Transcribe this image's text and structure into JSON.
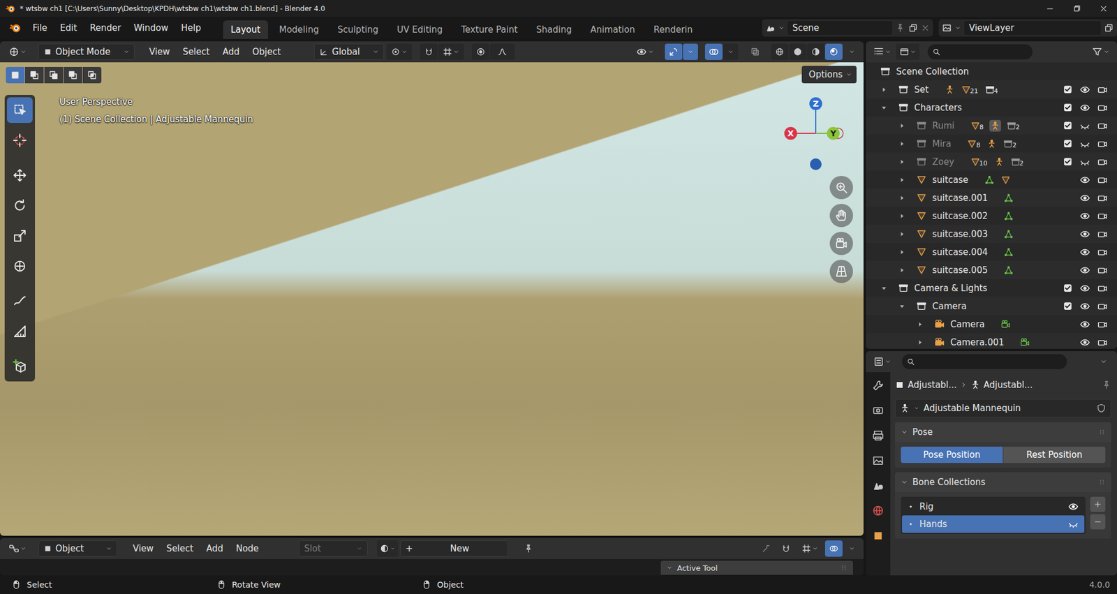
{
  "window": {
    "title": "* wtsbw ch1 [C:\\Users\\Sunny\\Desktop\\KPDH\\wtsbw ch1\\wtsbw ch1.blend] - Blender 4.0"
  },
  "menubar": {
    "menus": [
      "File",
      "Edit",
      "Render",
      "Window",
      "Help"
    ],
    "workspaces": [
      {
        "label": "Layout",
        "selected": true
      },
      {
        "label": "Modeling",
        "selected": false
      },
      {
        "label": "Sculpting",
        "selected": false
      },
      {
        "label": "UV Editing",
        "selected": false
      },
      {
        "label": "Texture Paint",
        "selected": false
      },
      {
        "label": "Shading",
        "selected": false
      },
      {
        "label": "Animation",
        "selected": false
      },
      {
        "label": "Renderin",
        "selected": false
      }
    ],
    "scene": "Scene",
    "view_layer": "ViewLayer"
  },
  "viewport_header": {
    "mode": "Object Mode",
    "menus": [
      "View",
      "Select",
      "Add",
      "Object"
    ],
    "orientation": "Global",
    "gizmos": true,
    "overlays": true,
    "xray": false,
    "shading": [
      {
        "selected": false
      },
      {
        "selected": false
      },
      {
        "selected": false
      },
      {
        "selected": true
      }
    ]
  },
  "select_modes": [
    {
      "selected": true
    },
    {
      "selected": false
    },
    {
      "selected": false
    },
    {
      "selected": false
    },
    {
      "selected": false
    }
  ],
  "tools": [
    {
      "selected": true
    },
    {
      "selected": false
    },
    {
      "selected": false
    },
    {
      "selected": false
    },
    {
      "selected": false
    },
    {
      "selected": false
    },
    {
      "selected": false
    },
    {
      "selected": false
    },
    {
      "selected": false
    }
  ],
  "viewport": {
    "info": [
      "User Perspective",
      "(1) Scene Collection | Adjustable Mannequin"
    ],
    "options": "Options",
    "axes": {
      "z": "Z",
      "x": "X",
      "y": "Y"
    }
  },
  "outliner": {
    "rows": [
      {
        "label": "Scene Collection",
        "depth": 0,
        "kind": "root",
        "expanded": true,
        "dimmed": false,
        "badges": []
      },
      {
        "label": "Set",
        "depth": 1,
        "kind": "collection",
        "expanded": false,
        "dimmed": false,
        "checked": true,
        "visible": true,
        "renderable": true,
        "badges": [
          {
            "kind": "armature",
            "count": "",
            "highlighted": false
          },
          {
            "kind": "mesh",
            "count": "21",
            "highlighted": false
          },
          {
            "kind": "collection",
            "count": "4",
            "highlighted": false
          }
        ]
      },
      {
        "label": "Characters",
        "depth": 1,
        "kind": "collection",
        "expanded": true,
        "dimmed": false,
        "checked": true,
        "visible": true,
        "renderable": true,
        "badges": []
      },
      {
        "label": "Rumi",
        "depth": 2,
        "kind": "collection",
        "expanded": false,
        "dimmed": true,
        "checked": true,
        "visible": false,
        "renderable": true,
        "badges": [
          {
            "kind": "mesh",
            "count": "8",
            "highlighted": false
          },
          {
            "kind": "armature",
            "count": "",
            "highlighted": true
          },
          {
            "kind": "collection",
            "count": "2",
            "highlighted": false
          }
        ]
      },
      {
        "label": "Mira",
        "depth": 2,
        "kind": "collection",
        "expanded": false,
        "dimmed": true,
        "checked": true,
        "visible": false,
        "renderable": true,
        "badges": [
          {
            "kind": "mesh",
            "count": "8",
            "highlighted": false
          },
          {
            "kind": "armature",
            "count": "",
            "highlighted": false
          },
          {
            "kind": "collection",
            "count": "2",
            "highlighted": false
          }
        ]
      },
      {
        "label": "Zoey",
        "depth": 2,
        "kind": "collection",
        "expanded": false,
        "dimmed": true,
        "checked": true,
        "visible": false,
        "renderable": true,
        "badges": [
          {
            "kind": "mesh",
            "count": "10",
            "highlighted": false
          },
          {
            "kind": "armature",
            "count": "",
            "highlighted": false
          },
          {
            "kind": "collection",
            "count": "2",
            "highlighted": false
          }
        ]
      },
      {
        "label": "suitcase",
        "depth": 2,
        "kind": "mesh",
        "expanded": false,
        "dimmed": false,
        "visible": true,
        "renderable": true,
        "badges": [
          {
            "kind": "meshdata",
            "count": "",
            "highlighted": false
          },
          {
            "kind": "mesh",
            "count": "",
            "highlighted": false
          }
        ]
      },
      {
        "label": "suitcase.001",
        "depth": 2,
        "kind": "mesh",
        "expanded": false,
        "dimmed": false,
        "visible": true,
        "renderable": true,
        "badges": [
          {
            "kind": "meshdata",
            "count": "",
            "highlighted": false
          }
        ]
      },
      {
        "label": "suitcase.002",
        "depth": 2,
        "kind": "mesh",
        "expanded": false,
        "dimmed": false,
        "visible": true,
        "renderable": true,
        "badges": [
          {
            "kind": "meshdata",
            "count": "",
            "highlighted": false
          }
        ]
      },
      {
        "label": "suitcase.003",
        "depth": 2,
        "kind": "mesh",
        "expanded": false,
        "dimmed": false,
        "visible": true,
        "renderable": true,
        "badges": [
          {
            "kind": "meshdata",
            "count": "",
            "highlighted": false
          }
        ]
      },
      {
        "label": "suitcase.004",
        "depth": 2,
        "kind": "mesh",
        "expanded": false,
        "dimmed": false,
        "visible": true,
        "renderable": true,
        "badges": [
          {
            "kind": "meshdata",
            "count": "",
            "highlighted": false
          }
        ]
      },
      {
        "label": "suitcase.005",
        "depth": 2,
        "kind": "mesh",
        "expanded": false,
        "dimmed": false,
        "visible": true,
        "renderable": true,
        "badges": [
          {
            "kind": "meshdata",
            "count": "",
            "highlighted": false
          }
        ]
      },
      {
        "label": "Camera & Lights",
        "depth": 1,
        "kind": "collection",
        "expanded": true,
        "dimmed": false,
        "checked": true,
        "visible": true,
        "renderable": true,
        "badges": []
      },
      {
        "label": "Camera",
        "depth": 2,
        "kind": "collection",
        "expanded": true,
        "dimmed": false,
        "checked": true,
        "visible": true,
        "renderable": true,
        "badges": []
      },
      {
        "label": "Camera",
        "depth": 3,
        "kind": "camera",
        "expanded": false,
        "dimmed": false,
        "visible": true,
        "renderable": true,
        "badges": [
          {
            "kind": "cameradata",
            "count": "",
            "highlighted": false
          }
        ]
      },
      {
        "label": "Camera.001",
        "depth": 3,
        "kind": "camera",
        "expanded": false,
        "dimmed": false,
        "visible": true,
        "renderable": true,
        "badges": [
          {
            "kind": "cameradata",
            "count": "",
            "highlighted": false
          }
        ]
      }
    ]
  },
  "properties": {
    "breadcrumb": [
      "Adjustabl...",
      "Adjustabl..."
    ],
    "datablock": "Adjustable Mannequin",
    "pose_panel": {
      "title": "Pose",
      "expanded": true,
      "buttons": [
        {
          "label": "Pose Position",
          "selected": true
        },
        {
          "label": "Rest Position",
          "selected": false
        }
      ]
    },
    "bone_panel": {
      "title": "Bone Collections",
      "expanded": true,
      "items": [
        {
          "label": "Rig",
          "selected": false,
          "visible": true
        },
        {
          "label": "Hands",
          "selected": true,
          "visible": false
        }
      ]
    }
  },
  "node_header": {
    "editor": "Object",
    "menus": [
      "View",
      "Select",
      "Add",
      "Node"
    ],
    "slot": "Slot",
    "new_glyph": "+",
    "new_label": "New",
    "panel": "Active Tool"
  },
  "status_bar": {
    "items": [
      "Select",
      "Rotate View",
      "Object"
    ],
    "version": "4.0.0"
  }
}
